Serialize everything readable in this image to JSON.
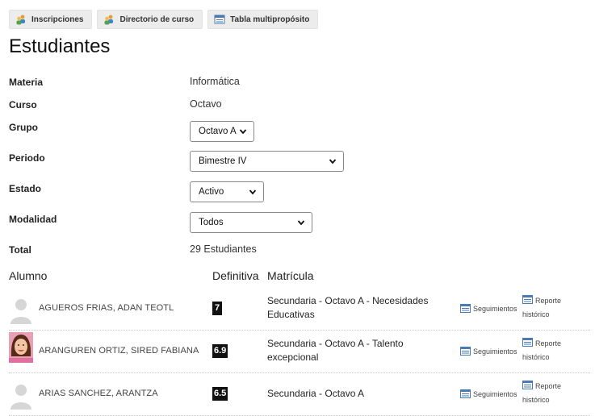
{
  "toolbar": {
    "inscripciones": "Inscripciones",
    "directorio": "Directorio de curso",
    "tabla": "Tabla multipropósito"
  },
  "title": "Estudiantes",
  "fields": {
    "materia_label": "Materia",
    "materia_value": "Informática",
    "curso_label": "Curso",
    "curso_value": "Octavo",
    "grupo_label": "Grupo",
    "grupo_value": "Octavo A",
    "periodo_label": "Periodo",
    "periodo_value": "Bimestre IV",
    "estado_label": "Estado",
    "estado_value": "Activo",
    "modalidad_label": "Modalidad",
    "modalidad_value": "Todos",
    "total_label": "Total",
    "total_value": "29 Estudiantes"
  },
  "table": {
    "headers": {
      "alumno": "Alumno",
      "definitiva": "Definitiva",
      "matricula": "Matrícula"
    },
    "rows": [
      {
        "name": "AGUEROS FRIAS, ADAN TEOTL",
        "grade": "7",
        "matricula": "Secundaria - Octavo A - Necesidades Educativas",
        "seguimientos": "Seguimientos",
        "reporte": "Reporte histórico",
        "avatar": "placeholder"
      },
      {
        "name": "ARANGUREN ORTIZ, SIRED FABIANA",
        "grade": "6.9",
        "matricula": "Secundaria - Octavo A - Talento excepcional",
        "seguimientos": "Seguimientos",
        "reporte": "Reporte histórico",
        "avatar": "photo"
      },
      {
        "name": "ARIAS SANCHEZ, ARANTZA",
        "grade": "6.5",
        "matricula": "Secundaria - Octavo A",
        "seguimientos": "Seguimientos",
        "reporte": "Reporte histórico",
        "avatar": "placeholder"
      }
    ]
  },
  "icons": {
    "inscripciones": "users-icon",
    "directorio": "users-icon",
    "tabla": "table-icon",
    "seguimientos": "table-icon",
    "reporte": "table-icon"
  },
  "colors": {
    "grade_bg": "#111111",
    "toolbar_bg": "#ececec",
    "table_icon": "#4a7ab5"
  }
}
